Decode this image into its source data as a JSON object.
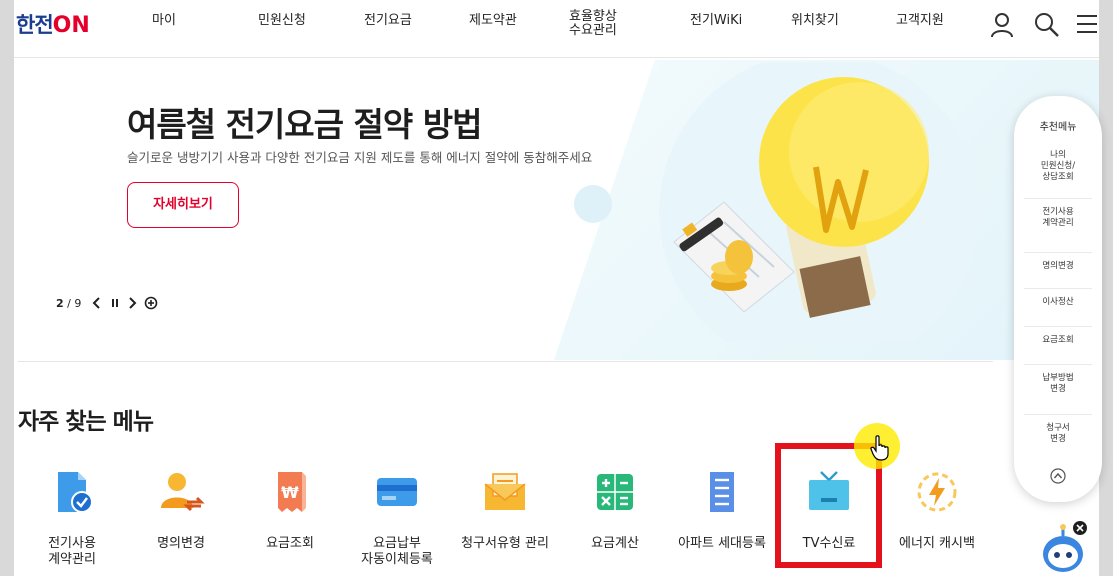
{
  "header": {
    "logo_text": "한전",
    "logo_on": "ON",
    "nav": [
      "마이",
      "민원신청",
      "전기요금",
      "제도약관",
      "효율향상\n수요관리",
      "전기WiKi",
      "위치찾기",
      "고객지원"
    ],
    "icons": [
      "user-icon",
      "search-icon",
      "menu-icon"
    ]
  },
  "hero": {
    "title": "여름철 전기요금 절약 방법",
    "subtitle": "슬기로운 냉방기기 사용과 다양한 전기요금 지원 제도를 통해 에너지 절약에 동참해주세요",
    "button": "자세히보기",
    "pager_current": "2",
    "pager_total": "9"
  },
  "frequent": {
    "title": "자주 찾는 메뉴",
    "items": [
      {
        "label": "전기사용\n계약관리",
        "icon": "contract-icon"
      },
      {
        "label": "명의변경",
        "icon": "person-change-icon"
      },
      {
        "label": "요금조회",
        "icon": "bill-icon"
      },
      {
        "label": "요금납부\n자동이체등록",
        "icon": "card-icon"
      },
      {
        "label": "청구서유형 관리",
        "icon": "mail-icon"
      },
      {
        "label": "요금계산",
        "icon": "calculator-icon"
      },
      {
        "label": "아파트 세대등록",
        "icon": "apartment-icon"
      },
      {
        "label": "TV수신료",
        "icon": "tv-icon"
      },
      {
        "label": "에너지 캐시백",
        "icon": "energy-icon"
      }
    ]
  },
  "rail": {
    "title": "추천메뉴",
    "items": [
      "나의\n민원신청/\n상담조회",
      "전기사용\n계약관리",
      "명의변경",
      "이사정산",
      "요금조회",
      "납부방법\n변경",
      "청구서\n변경"
    ]
  },
  "colors": {
    "brand_blue": "#1a3d8f",
    "brand_red": "#e4002b",
    "highlight_red": "#e3121c",
    "bulb_yellow": "#fde34a"
  }
}
